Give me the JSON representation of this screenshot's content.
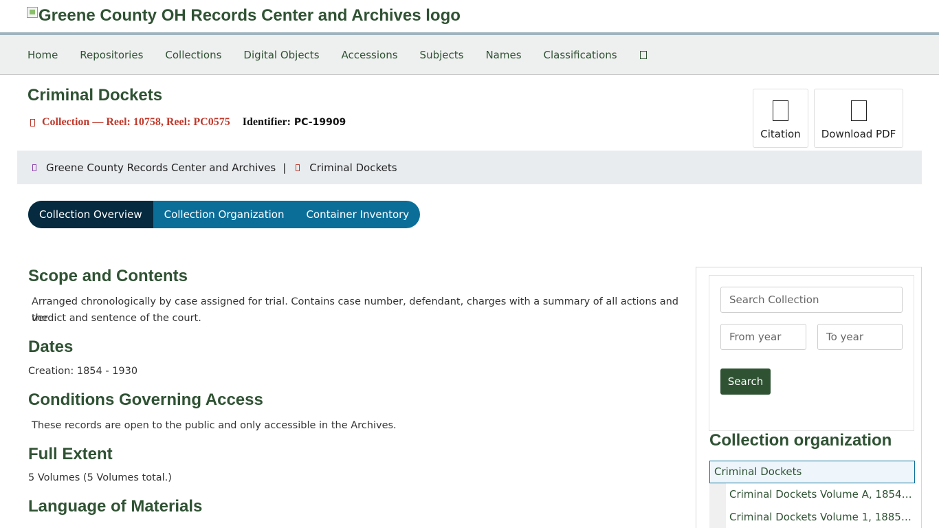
{
  "header": {
    "logo_alt": "Greene County OH Records Center and Archives logo"
  },
  "nav": {
    "items": [
      {
        "label": "Home"
      },
      {
        "label": "Repositories"
      },
      {
        "label": "Collections"
      },
      {
        "label": "Digital Objects"
      },
      {
        "label": "Accessions"
      },
      {
        "label": "Subjects"
      },
      {
        "label": "Names"
      },
      {
        "label": "Classifications"
      }
    ],
    "search_icon": "search-icon"
  },
  "record": {
    "title": "Criminal Dockets",
    "collection_label": "Collection — Reel: 10758, Reel: PC0575",
    "identifier_label": "Identifier:",
    "identifier_value": "PC-19909"
  },
  "actions": {
    "citation": "Citation",
    "download_pdf": "Download PDF"
  },
  "breadcrumb": {
    "repository": "Greene County Records Center and Archives",
    "separator": "|",
    "current": "Criminal Dockets"
  },
  "tabs": {
    "overview": "Collection Overview",
    "organization": "Collection Organization",
    "inventory": "Container Inventory"
  },
  "sections": {
    "scope_heading": "Scope and Contents",
    "scope_line1": "Arranged chronologically by case assigned for trial. Contains case number, defendant, charges with a summary of all actions and the",
    "scope_line2": "verdict and sentence of the court.",
    "dates_heading": "Dates",
    "dates_text": "Creation: 1854 - 1930",
    "access_heading": "Conditions Governing Access",
    "access_text": "These records are open to the public and only accessible in the Archives.",
    "extent_heading": "Full Extent",
    "extent_text": "5 Volumes (5 Volumes total.)",
    "language_heading": "Language of Materials"
  },
  "sidebar": {
    "search_placeholder": "Search Collection",
    "from_placeholder": "From year",
    "to_placeholder": "To year",
    "search_button": "Search",
    "org_title": "Collection organization",
    "tree_root": "Criminal Dockets",
    "tree_children": [
      "Criminal Dockets Volume A, 1854-1…",
      "Criminal Dockets Volume 1, 1885-18…"
    ]
  },
  "colors": {
    "brand_green": "#2f5233",
    "tab_blue": "#0b6e99",
    "tab_active": "#062a3f",
    "collection_red": "#c0392b"
  }
}
